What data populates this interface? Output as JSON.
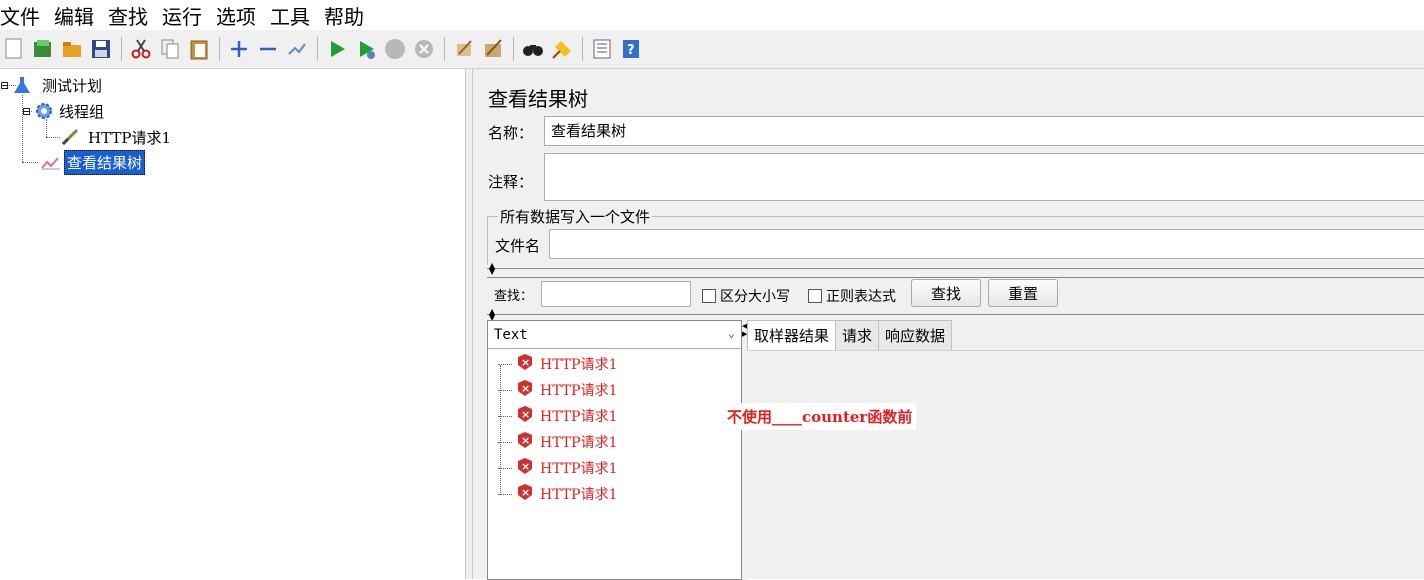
{
  "menu": [
    "文件",
    "编辑",
    "查找",
    "运行",
    "选项",
    "工具",
    "帮助"
  ],
  "toolbar_icons": [
    "new-icon",
    "templates-icon",
    "open-icon",
    "save-icon",
    "cut-icon",
    "copy-icon",
    "paste-icon",
    "expand-icon",
    "collapse-icon",
    "toggle-icon",
    "start-icon",
    "start-no-timers-icon",
    "stop-icon",
    "shutdown-icon",
    "clear-icon",
    "clear-all-icon",
    "search-icon",
    "reset-search-icon",
    "function-helper-icon",
    "help-icon"
  ],
  "tree": {
    "root": "测试计划",
    "thread_group": "线程组",
    "sampler": "HTTP请求1",
    "listener": "查看结果树"
  },
  "panel": {
    "title": "查看结果树",
    "name_label": "名称：",
    "name_value": "查看结果树",
    "comment_label": "注释：",
    "comment_value": "",
    "file_group_legend": "所有数据写入一个文件",
    "filename_label": "文件名",
    "filename_value": ""
  },
  "search": {
    "label": "查找：",
    "value": "",
    "case_sensitive": "区分大小写",
    "regex": "正则表达式",
    "find_button": "查找",
    "reset_button": "重置"
  },
  "results": {
    "renderer": "Text",
    "items": [
      "HTTP请求1",
      "HTTP请求1",
      "HTTP请求1",
      "HTTP请求1",
      "HTTP请求1",
      "HTTP请求1"
    ]
  },
  "tabs": [
    "取样器结果",
    "请求",
    "响应数据"
  ],
  "annotation": "不使用____counter函数前",
  "colors": {
    "error_red": "#e02020",
    "selection_blue": "#1a5fd0"
  }
}
